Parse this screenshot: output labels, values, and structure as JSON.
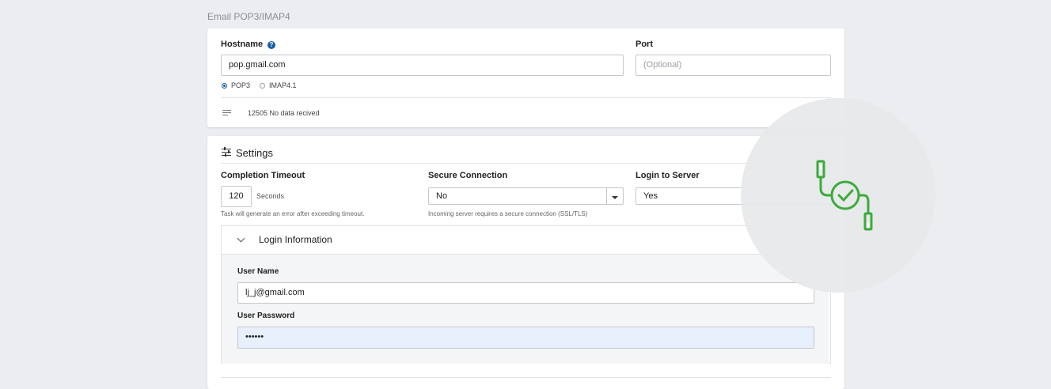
{
  "section": {
    "title": "Email POP3/IMAP4"
  },
  "connection": {
    "hostname_label": "Hostname",
    "help_glyph": "?",
    "hostname_value": "pop.gmail.com",
    "port_label": "Port",
    "port_placeholder": "(Optional)",
    "protocols": [
      {
        "label": "POP3",
        "selected": true
      },
      {
        "label": "IMAP4.1",
        "selected": false
      }
    ],
    "status_text": "12505 No data recived"
  },
  "settings": {
    "title": "Settings",
    "completion_timeout": {
      "label": "Completion Timeout",
      "value": "120",
      "unit": "Seconds",
      "hint": "Task will generate an error after exceeding timeout."
    },
    "secure_connection": {
      "label": "Secure Connection",
      "value": "No",
      "hint": "Incoming server requires a secure connection (SSL/TLS)"
    },
    "login_to_server": {
      "label": "Login to Server",
      "value": "Yes"
    }
  },
  "login_info": {
    "title": "Login Information",
    "user_name_label": "User Name",
    "user_name_value": "lj_j@gmail.com",
    "password_label": "User Password",
    "password_value": "••••••"
  },
  "colors": {
    "accent": "#1a5fa8",
    "success": "#3cab3c",
    "background": "#ebedf0"
  },
  "icons": [
    "help-icon",
    "radio-icon",
    "lines-icon",
    "settings-sliders-icon",
    "chevron-down-icon",
    "dropdown-arrow-icon",
    "connection-success-icon"
  ]
}
